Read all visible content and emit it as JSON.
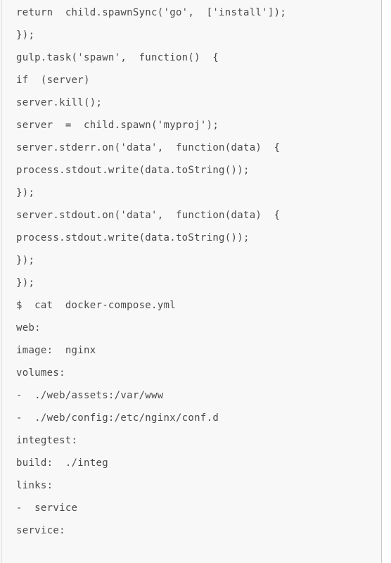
{
  "code_block": {
    "lines": [
      "return  child.spawnSync('go',  ['install']);",
      "});",
      "gulp.task('spawn',  function()  {",
      "if  (server)",
      "server.kill();",
      "server  =  child.spawn('myproj');",
      "server.stderr.on('data',  function(data)  {",
      "process.stdout.write(data.toString());",
      "});",
      "server.stdout.on('data',  function(data)  {",
      "process.stdout.write(data.toString());",
      "});",
      "});",
      "$  cat  docker-compose.yml",
      "web:",
      "image:  nginx",
      "volumes:",
      "-  ./web/assets:/var/www",
      "-  ./web/config:/etc/nginx/conf.d",
      "integtest:",
      "build:  ./integ",
      "links:",
      "-  service",
      "service:"
    ]
  }
}
